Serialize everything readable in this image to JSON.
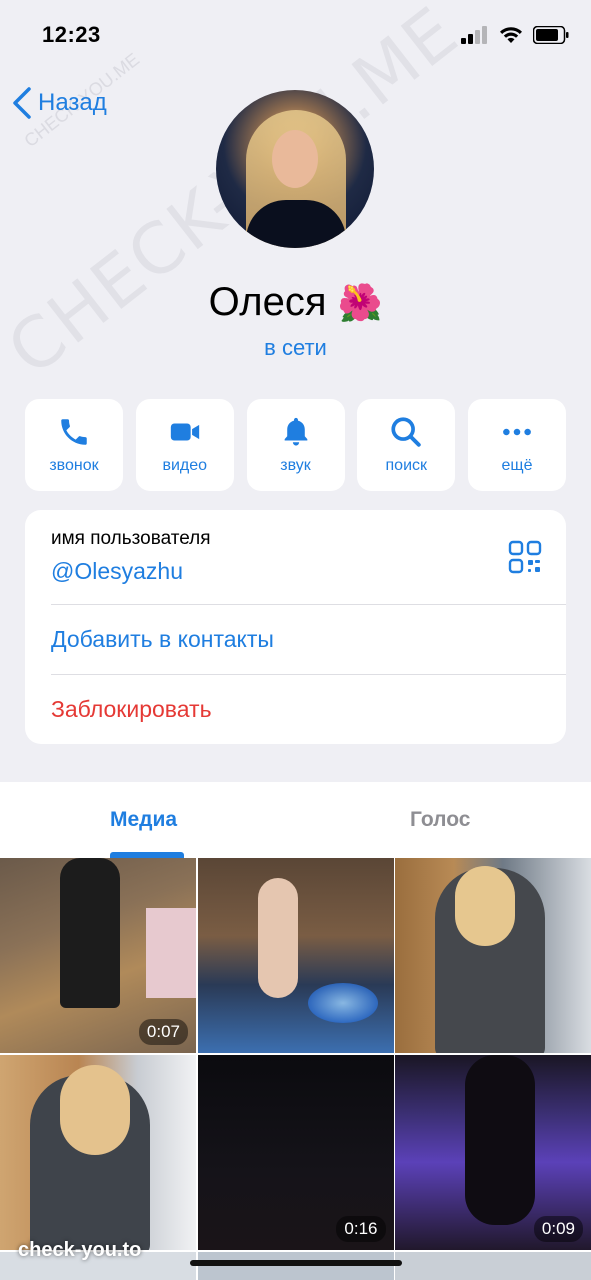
{
  "status": {
    "time": "12:23"
  },
  "watermark": {
    "big": "CHECK-YOU.ME",
    "small": "CHECK-YOU.ME",
    "bottom": "check-you.to"
  },
  "nav": {
    "back_label": "Назад"
  },
  "profile": {
    "name": "Олеся",
    "emoji": "🌺",
    "status": "в сети"
  },
  "actions": [
    {
      "label": "звонок",
      "icon": "phone-icon"
    },
    {
      "label": "видео",
      "icon": "video-icon"
    },
    {
      "label": "звук",
      "icon": "bell-icon"
    },
    {
      "label": "поиск",
      "icon": "search-icon"
    },
    {
      "label": "ещё",
      "icon": "more-icon"
    }
  ],
  "info": {
    "username_label": "имя пользователя",
    "username": "@Olesyazhu",
    "add_contact": "Добавить в контакты",
    "block": "Заблокировать"
  },
  "tabs": {
    "media": "Медиа",
    "voice": "Голос"
  },
  "media": [
    {
      "duration": "0:07"
    },
    {
      "duration": ""
    },
    {
      "duration": ""
    },
    {
      "duration": ""
    },
    {
      "duration": "0:16"
    },
    {
      "duration": "0:09"
    }
  ],
  "colors": {
    "accent": "#1f7ee0",
    "danger": "#e53935",
    "background": "#efeff4"
  }
}
